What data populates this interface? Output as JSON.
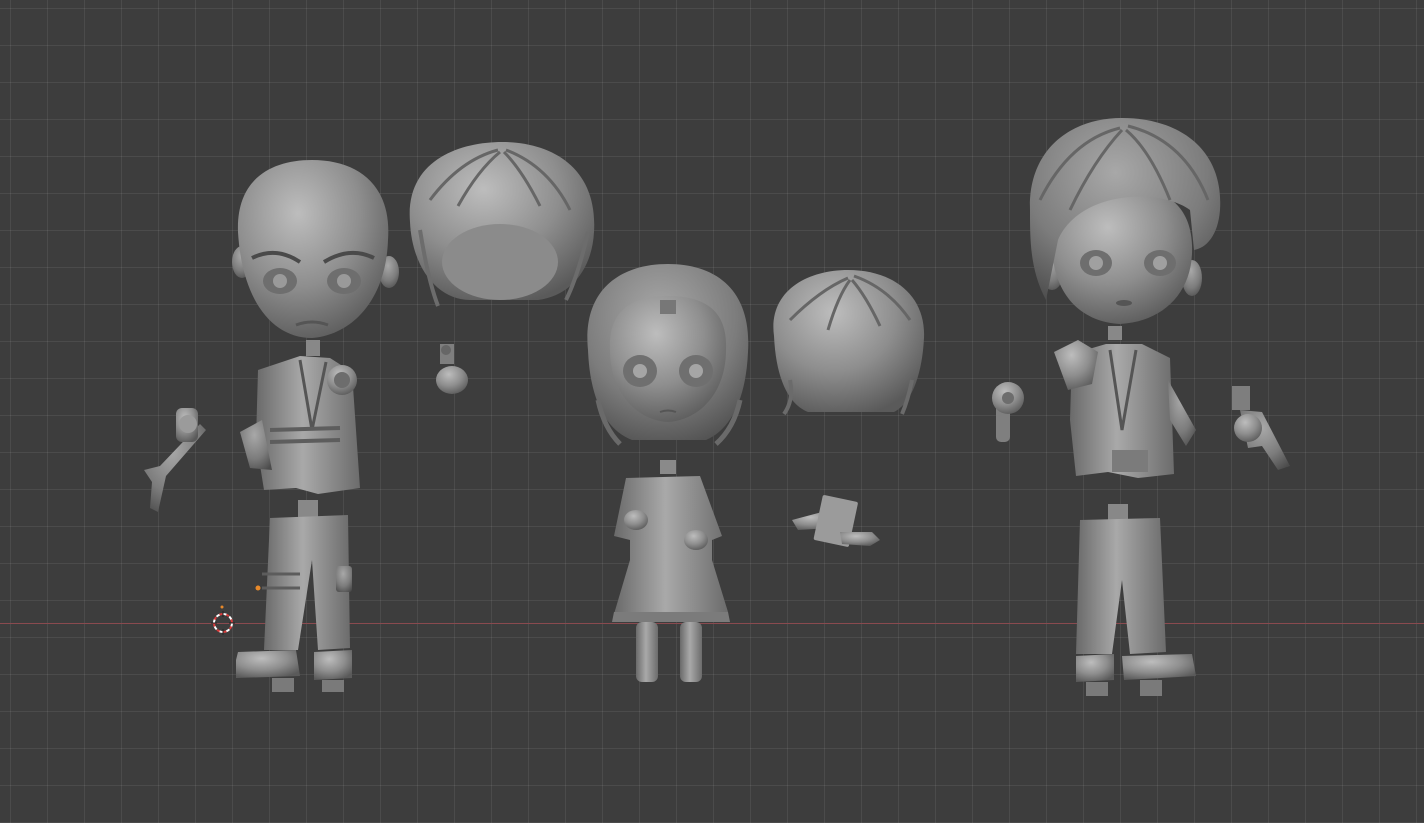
{
  "viewport": {
    "name": "3D Viewport",
    "background_color": "#3d3d3d",
    "grid_color": "#4a4a4a",
    "x_axis_color": "#8a4a4f",
    "mesh_color": "#8d8d8d"
  },
  "scene": {
    "objects": [
      "bald-head",
      "jacket-torso-left",
      "pants-left",
      "axe-hand",
      "gun-hand-small",
      "hair-swept",
      "girl-head",
      "girl-dress",
      "hair-messy",
      "hands-holding-card",
      "wavy-hair-head",
      "jacket-torso-right",
      "pants-right",
      "fist-hand",
      "gun-hand-right"
    ]
  }
}
